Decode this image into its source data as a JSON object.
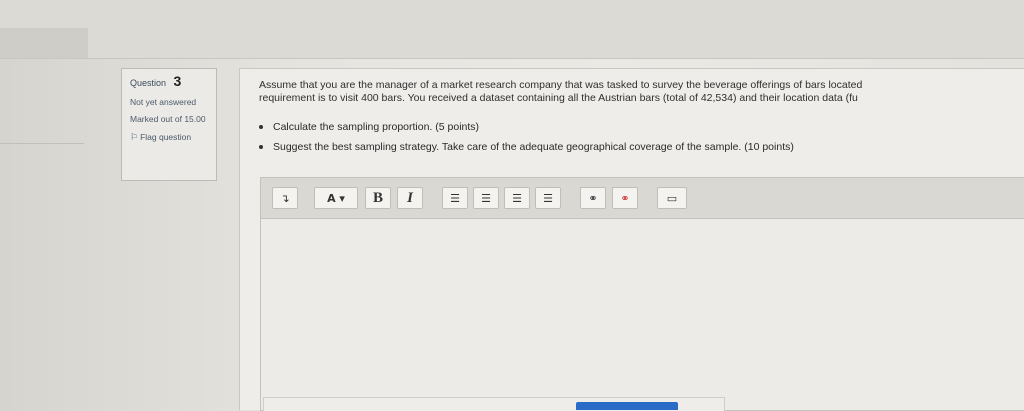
{
  "question": {
    "label": "Question",
    "number": "3",
    "state": "Not yet answered",
    "marked_out_of": "Marked out of 15.00",
    "flag_label": "Flag question",
    "text_line1": "Assume that you are the manager of a market research company that was tasked to survey the beverage offerings of bars located",
    "text_line2": "requirement is to visit 400 bars. You received a dataset containing all the Austrian bars (total of 42,534) and their location data (fu",
    "bullets": [
      "Calculate the sampling proportion. (5 points)",
      "Suggest the best sampling strategy. Take care of the adequate geographical coverage of the sample. (10 points)"
    ]
  },
  "toolbar": {
    "items": [
      {
        "name": "toolbar-toggle-button",
        "glyph": "↴"
      },
      {
        "name": "paragraph-style-button",
        "glyph": "A ▾"
      },
      {
        "name": "bold-button",
        "glyph": "B"
      },
      {
        "name": "italic-button",
        "glyph": "I"
      },
      {
        "name": "unordered-list-button",
        "glyph": "☰"
      },
      {
        "name": "ordered-list-button",
        "glyph": "☰"
      },
      {
        "name": "outdent-button",
        "glyph": "☰"
      },
      {
        "name": "indent-button",
        "glyph": "☰"
      },
      {
        "name": "link-button",
        "glyph": "⚭"
      },
      {
        "name": "unlink-button",
        "glyph": "⚭"
      },
      {
        "name": "image-button",
        "glyph": "▭"
      }
    ]
  },
  "colors": {
    "accent": "#2a6bc7",
    "panel_bg": "#efede9"
  }
}
